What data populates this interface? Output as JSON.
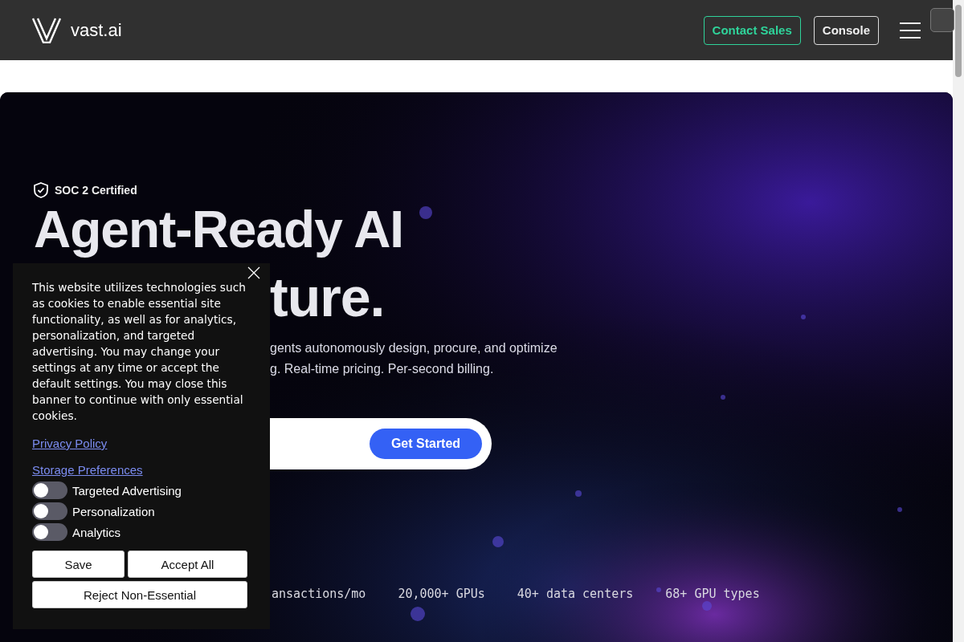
{
  "header": {
    "logo": "vast.ai",
    "buttons": [
      {
        "label": "Contact Sales",
        "kind": "accent"
      },
      {
        "label": "Console",
        "kind": "outline"
      }
    ]
  },
  "hero": {
    "kind": "picture",
    "badge": "SOC 2 Certified",
    "headline": [
      "Agent-Ready AI",
      "ture."
    ],
    "description": [
      "gents autonomously design, procure, and optimize",
      "g. Real-time pricing. Per-second billing."
    ],
    "cta": "Get Started",
    "stats": [
      "ansactions/mo",
      "20,000+ GPUs",
      "40+ data centers",
      "68+ GPU types"
    ]
  },
  "cookie_banner": {
    "text": "This website utilizes technologies such as cookies to enable essential site functionality, as well as for analytics, personalization, and targeted advertising. You may change your settings at any time or accept the default settings. You may close this banner to continue with only essential cookies.",
    "links": [
      "Privacy Policy",
      "Storage Preferences"
    ],
    "toggles": [
      {
        "label": "Targeted Advertising",
        "on": false
      },
      {
        "label": "Personalization",
        "on": false
      },
      {
        "label": "Analytics",
        "on": false
      }
    ],
    "buttons": [
      "Save",
      "Accept All",
      "Reject Non-Essential"
    ]
  }
}
